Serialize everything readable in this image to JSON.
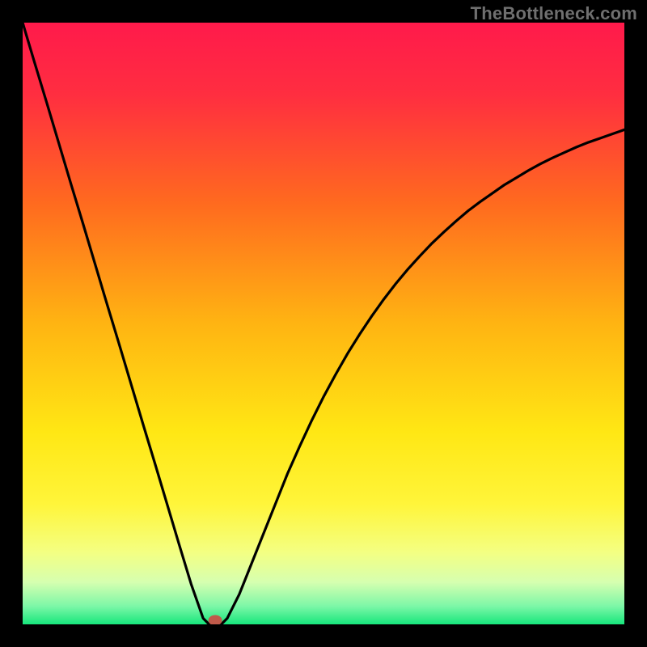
{
  "watermark": "TheBottleneck.com",
  "chart_data": {
    "type": "line",
    "title": "",
    "xlabel": "",
    "ylabel": "",
    "xlim": [
      0,
      100
    ],
    "ylim": [
      0,
      100
    ],
    "x": [
      0,
      2,
      4,
      6,
      8,
      10,
      12,
      14,
      16,
      18,
      20,
      22,
      24,
      26,
      28,
      30,
      31,
      32,
      33,
      34,
      36,
      38,
      40,
      42,
      44,
      46,
      48,
      50,
      52,
      54,
      56,
      58,
      60,
      62,
      64,
      66,
      68,
      70,
      72,
      74,
      76,
      78,
      80,
      82,
      84,
      86,
      88,
      90,
      92,
      94,
      96,
      98,
      100
    ],
    "values": [
      100,
      93.3,
      86.7,
      80,
      73.3,
      66.7,
      60,
      53.3,
      46.7,
      40,
      33.3,
      26.7,
      20,
      13.3,
      6.7,
      1,
      0,
      0,
      0,
      1,
      5,
      10,
      15,
      20,
      25,
      29.5,
      33.8,
      37.8,
      41.5,
      45,
      48.2,
      51.2,
      54,
      56.6,
      59,
      61.2,
      63.3,
      65.2,
      67,
      68.7,
      70.2,
      71.6,
      73,
      74.2,
      75.4,
      76.5,
      77.5,
      78.4,
      79.3,
      80.1,
      80.8,
      81.5,
      82.2
    ],
    "marker": {
      "x": 32,
      "y": 0
    },
    "colors": {
      "curve": "#000000",
      "marker": "#c05a4a",
      "gradient_top": "#ff1a4b",
      "gradient_bottom": "#17e67c"
    }
  }
}
